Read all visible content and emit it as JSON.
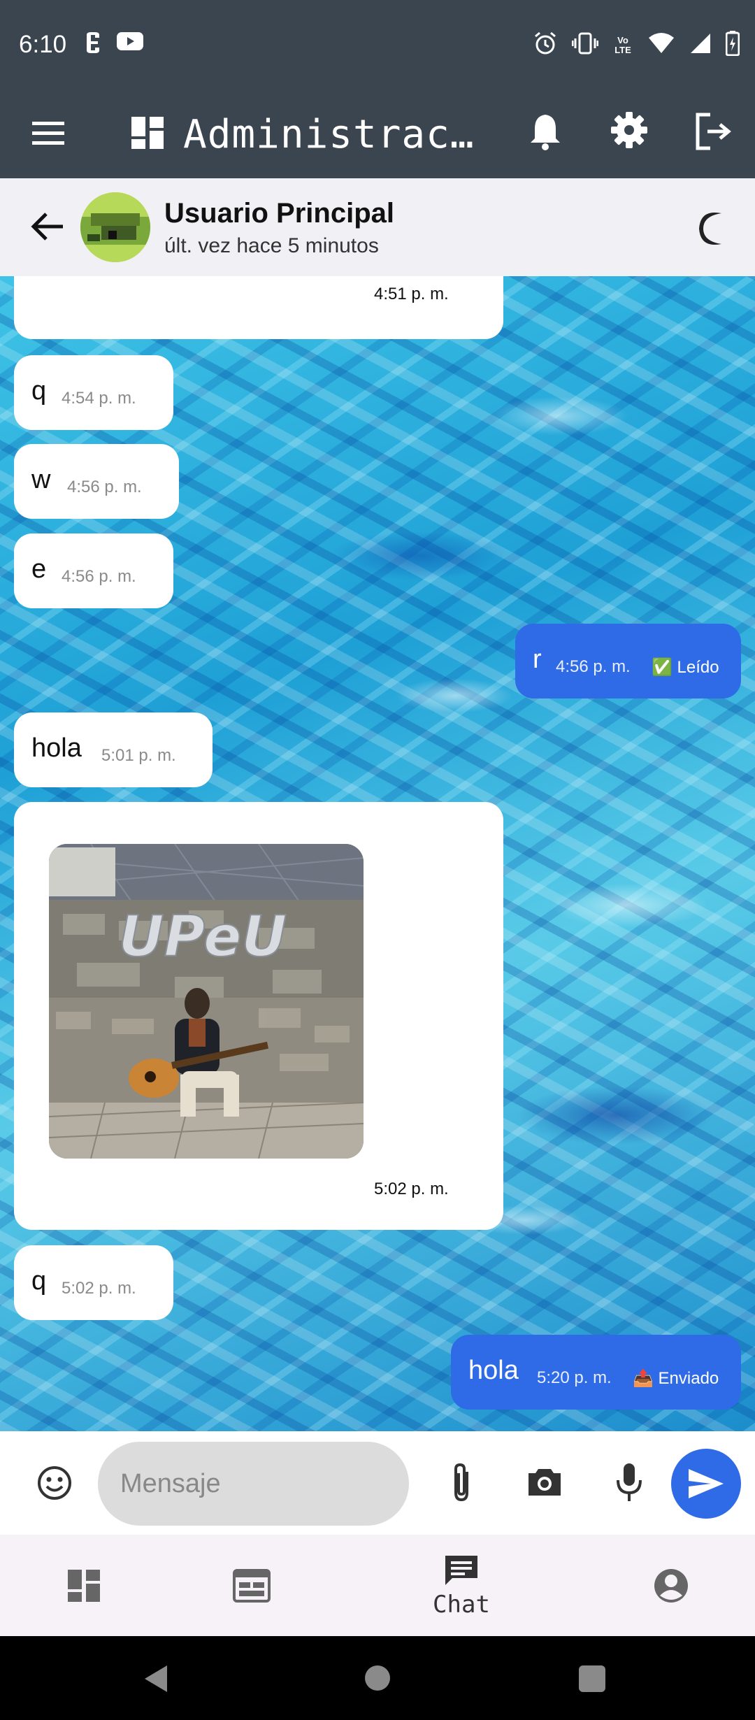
{
  "status_bar": {
    "time": "6:10",
    "left_icons": [
      "data-saver-icon",
      "youtube-icon"
    ],
    "right_icons": [
      "alarm-icon",
      "vibrate-icon",
      "volte-icon",
      "wifi-icon",
      "signal-icon",
      "battery-icon"
    ],
    "network_label": "Vo LTE"
  },
  "app_bar": {
    "title": "Administrac…",
    "icons": [
      "menu-icon",
      "dashboard-icon",
      "bell-icon",
      "gear-icon",
      "logout-icon"
    ]
  },
  "chat_header": {
    "contact_name": "Usuario Principal",
    "last_seen": "últ. vez hace 5 minutos",
    "icons": [
      "back-arrow-icon",
      "moon-icon"
    ]
  },
  "messages": [
    {
      "direction": "in",
      "text": "",
      "time": "4:51 p. m."
    },
    {
      "direction": "in",
      "text": "q",
      "time": "4:54 p. m."
    },
    {
      "direction": "in",
      "text": "w",
      "time": "4:56 p. m."
    },
    {
      "direction": "in",
      "text": "e",
      "time": "4:56 p. m."
    },
    {
      "direction": "out",
      "text": "r",
      "time": "4:56 p. m.",
      "status": "✅ Leído"
    },
    {
      "direction": "in",
      "text": "hola",
      "time": "5:01 p. m."
    },
    {
      "direction": "in",
      "type": "image",
      "image_caption_text": "UPeU",
      "time": "5:02 p. m."
    },
    {
      "direction": "in",
      "text": "q",
      "time": "5:02 p. m."
    },
    {
      "direction": "out",
      "text": "hola",
      "time": "5:20 p. m.",
      "status": "📤 Enviado"
    }
  ],
  "composer": {
    "placeholder": "Mensaje",
    "icons": [
      "emoji-icon",
      "paperclip-icon",
      "camera-icon",
      "microphone-icon",
      "send-icon"
    ]
  },
  "bottom_nav": {
    "items": [
      {
        "icon": "dashboard-icon",
        "label": ""
      },
      {
        "icon": "calendar-icon",
        "label": ""
      },
      {
        "icon": "chat-icon",
        "label": "Chat",
        "selected": true
      },
      {
        "icon": "account-icon",
        "label": ""
      }
    ]
  },
  "colors": {
    "app_bar": "#3b4550",
    "outgoing_bubble": "#2f6be6",
    "incoming_bubble": "#ffffff",
    "send_button": "#2f6be6"
  }
}
